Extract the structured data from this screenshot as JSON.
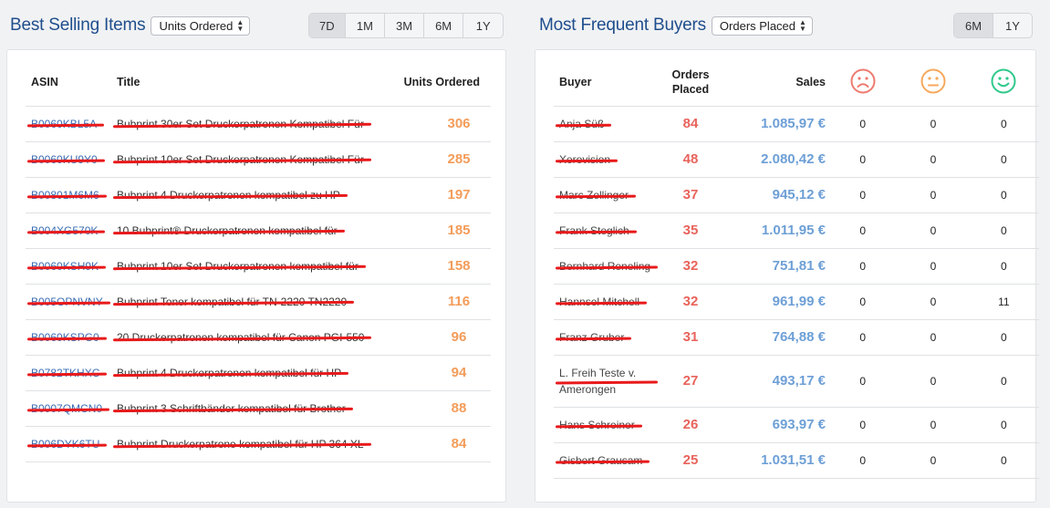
{
  "best_selling": {
    "title": "Best Selling Items",
    "select_value": "Units Ordered",
    "ranges": [
      "7D",
      "1M",
      "3M",
      "6M",
      "1Y"
    ],
    "active_range": "7D",
    "columns": {
      "asin": "ASIN",
      "title": "Title",
      "units": "Units Ordered"
    },
    "rows": [
      {
        "asin": "B0060KBL5A",
        "title": "Bubprint 30er Set Druckerpatronen Kompatibel Für",
        "units": "306"
      },
      {
        "asin": "B0060KU9Y0",
        "title": "Bubprint 10er Set Druckerpatronen Kompatibel Für",
        "units": "285"
      },
      {
        "asin": "B00801M6M6",
        "title": "Bubprint 4 Druckerpatronen kompatibel zu HP",
        "units": "197"
      },
      {
        "asin": "B004XG570K",
        "title": "10 Bubprint® Druckerpatronen kompatibel für",
        "units": "185"
      },
      {
        "asin": "B0060KSH9K",
        "title": "Bubprint 10er Set Druckerpatronen kompatibel für",
        "units": "158"
      },
      {
        "asin": "B005OPNVNY",
        "title": "Bubprint Toner kompatibel für TN-2220 TN2220",
        "units": "116"
      },
      {
        "asin": "B0060KSPG0",
        "title": "20 Druckerpatronen kompatibel für Canon PGI-550",
        "units": "96"
      },
      {
        "asin": "B0782TKHXC",
        "title": "Bubprint 4 Druckerpatronen kompatibel für HP",
        "units": "94"
      },
      {
        "asin": "B0007QMCN0",
        "title": "Bubprint 3 Schriftbänder kompatibel für Brother",
        "units": "88"
      },
      {
        "asin": "B006DYK6TU",
        "title": "Bubprint Druckerpatrone kompatibel für HP 364 XL",
        "units": "84"
      }
    ]
  },
  "frequent_buyers": {
    "title": "Most Frequent Buyers",
    "select_value": "Orders Placed",
    "ranges": [
      "6M",
      "1Y"
    ],
    "active_range": "6M",
    "columns": {
      "buyer": "Buyer",
      "orders_line1": "Orders",
      "orders_line2": "Placed",
      "sales": "Sales"
    },
    "rows": [
      {
        "buyer": "Anja Süß",
        "orders": "84",
        "sales": "1.085,97 €",
        "negative": "0",
        "neutral": "0",
        "positive": "0"
      },
      {
        "buyer": "Xerovision",
        "orders": "48",
        "sales": "2.080,42 €",
        "negative": "0",
        "neutral": "0",
        "positive": "0"
      },
      {
        "buyer": "Marc Zellinger",
        "orders": "37",
        "sales": "945,12 €",
        "negative": "0",
        "neutral": "0",
        "positive": "0"
      },
      {
        "buyer": "Frank Steglich",
        "orders": "35",
        "sales": "1.011,95 €",
        "negative": "0",
        "neutral": "0",
        "positive": "0"
      },
      {
        "buyer": "Bernhard Reneling",
        "orders": "32",
        "sales": "751,81 €",
        "negative": "0",
        "neutral": "0",
        "positive": "0"
      },
      {
        "buyer": "Hannsel Mitchell",
        "orders": "32",
        "sales": "961,99 €",
        "negative": "0",
        "neutral": "0",
        "positive": "11"
      },
      {
        "buyer": "Franz Gruber",
        "orders": "31",
        "sales": "764,88 €",
        "negative": "0",
        "neutral": "0",
        "positive": "0"
      },
      {
        "buyer": "L. Freih Teste v. Amerongen",
        "orders": "27",
        "sales": "493,17 €",
        "negative": "0",
        "neutral": "0",
        "positive": "0"
      },
      {
        "buyer": "Hans Schreiner",
        "orders": "26",
        "sales": "693,97 €",
        "negative": "0",
        "neutral": "0",
        "positive": "0"
      },
      {
        "buyer": "Gisbert Grausam",
        "orders": "25",
        "sales": "1.031,51 €",
        "negative": "0",
        "neutral": "0",
        "positive": "0"
      }
    ],
    "face_icons": [
      "sad-face-icon",
      "neutral-face-icon",
      "happy-face-icon"
    ],
    "colors": {
      "negative": "#ee7a6f",
      "neutral": "#f6a85c",
      "positive": "#2ec98a"
    }
  },
  "colors": {
    "title": "#1f4e8c",
    "units": "#f39c5a",
    "orders": "#e8635b",
    "sales": "#6d9fd6",
    "redaction": "#e8191b"
  }
}
